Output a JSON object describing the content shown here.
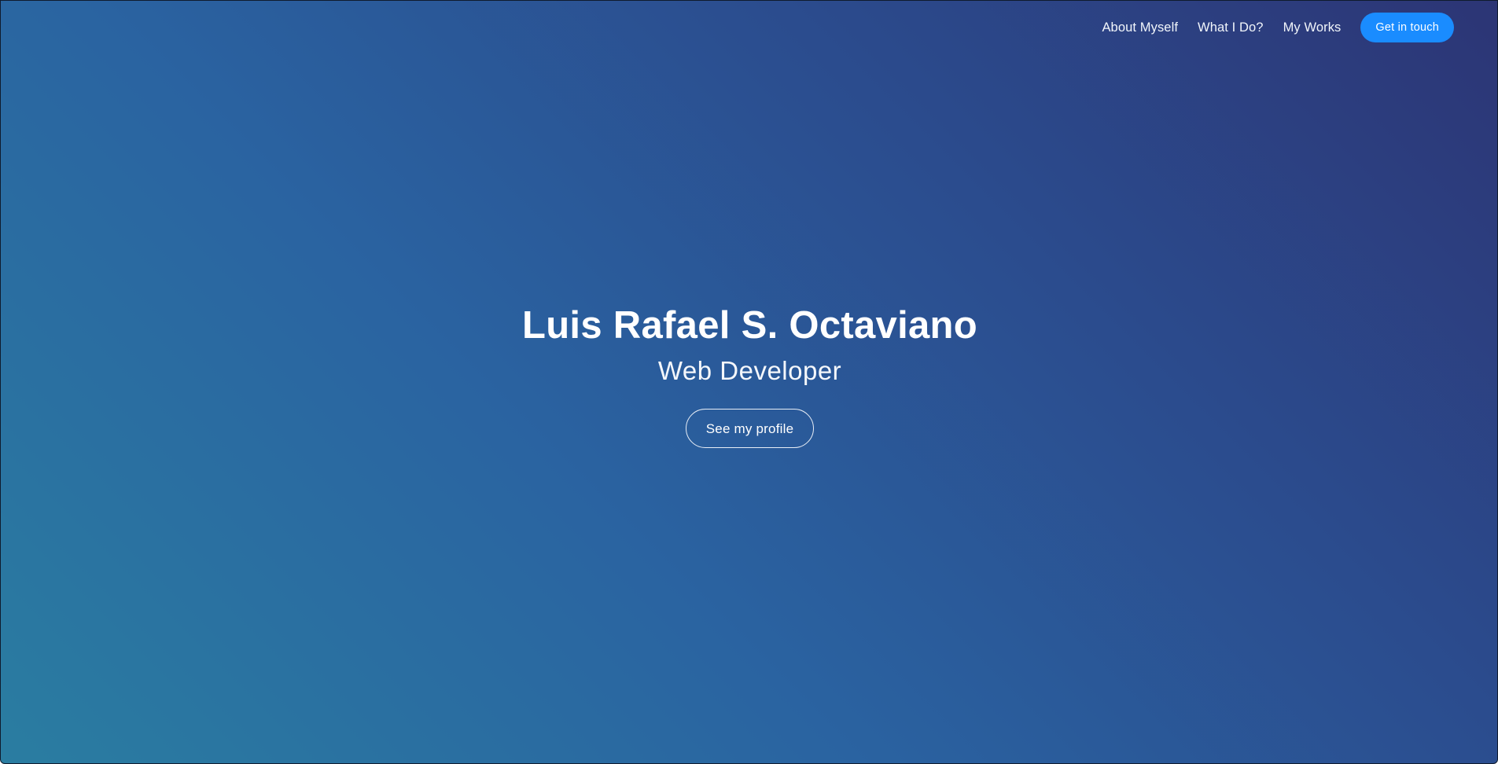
{
  "nav": {
    "links": [
      "About Myself",
      "What I Do?",
      "My Works"
    ],
    "cta_label": "Get in touch"
  },
  "hero": {
    "name": "Luis Rafael S. Octaviano",
    "role": "Web Developer",
    "button_label": "See my profile"
  },
  "colors": {
    "gradient_start": "#2a7da1",
    "gradient_mid": "#2a63a1",
    "gradient_end": "#2c3575",
    "cta_background": "#1a8cff"
  }
}
